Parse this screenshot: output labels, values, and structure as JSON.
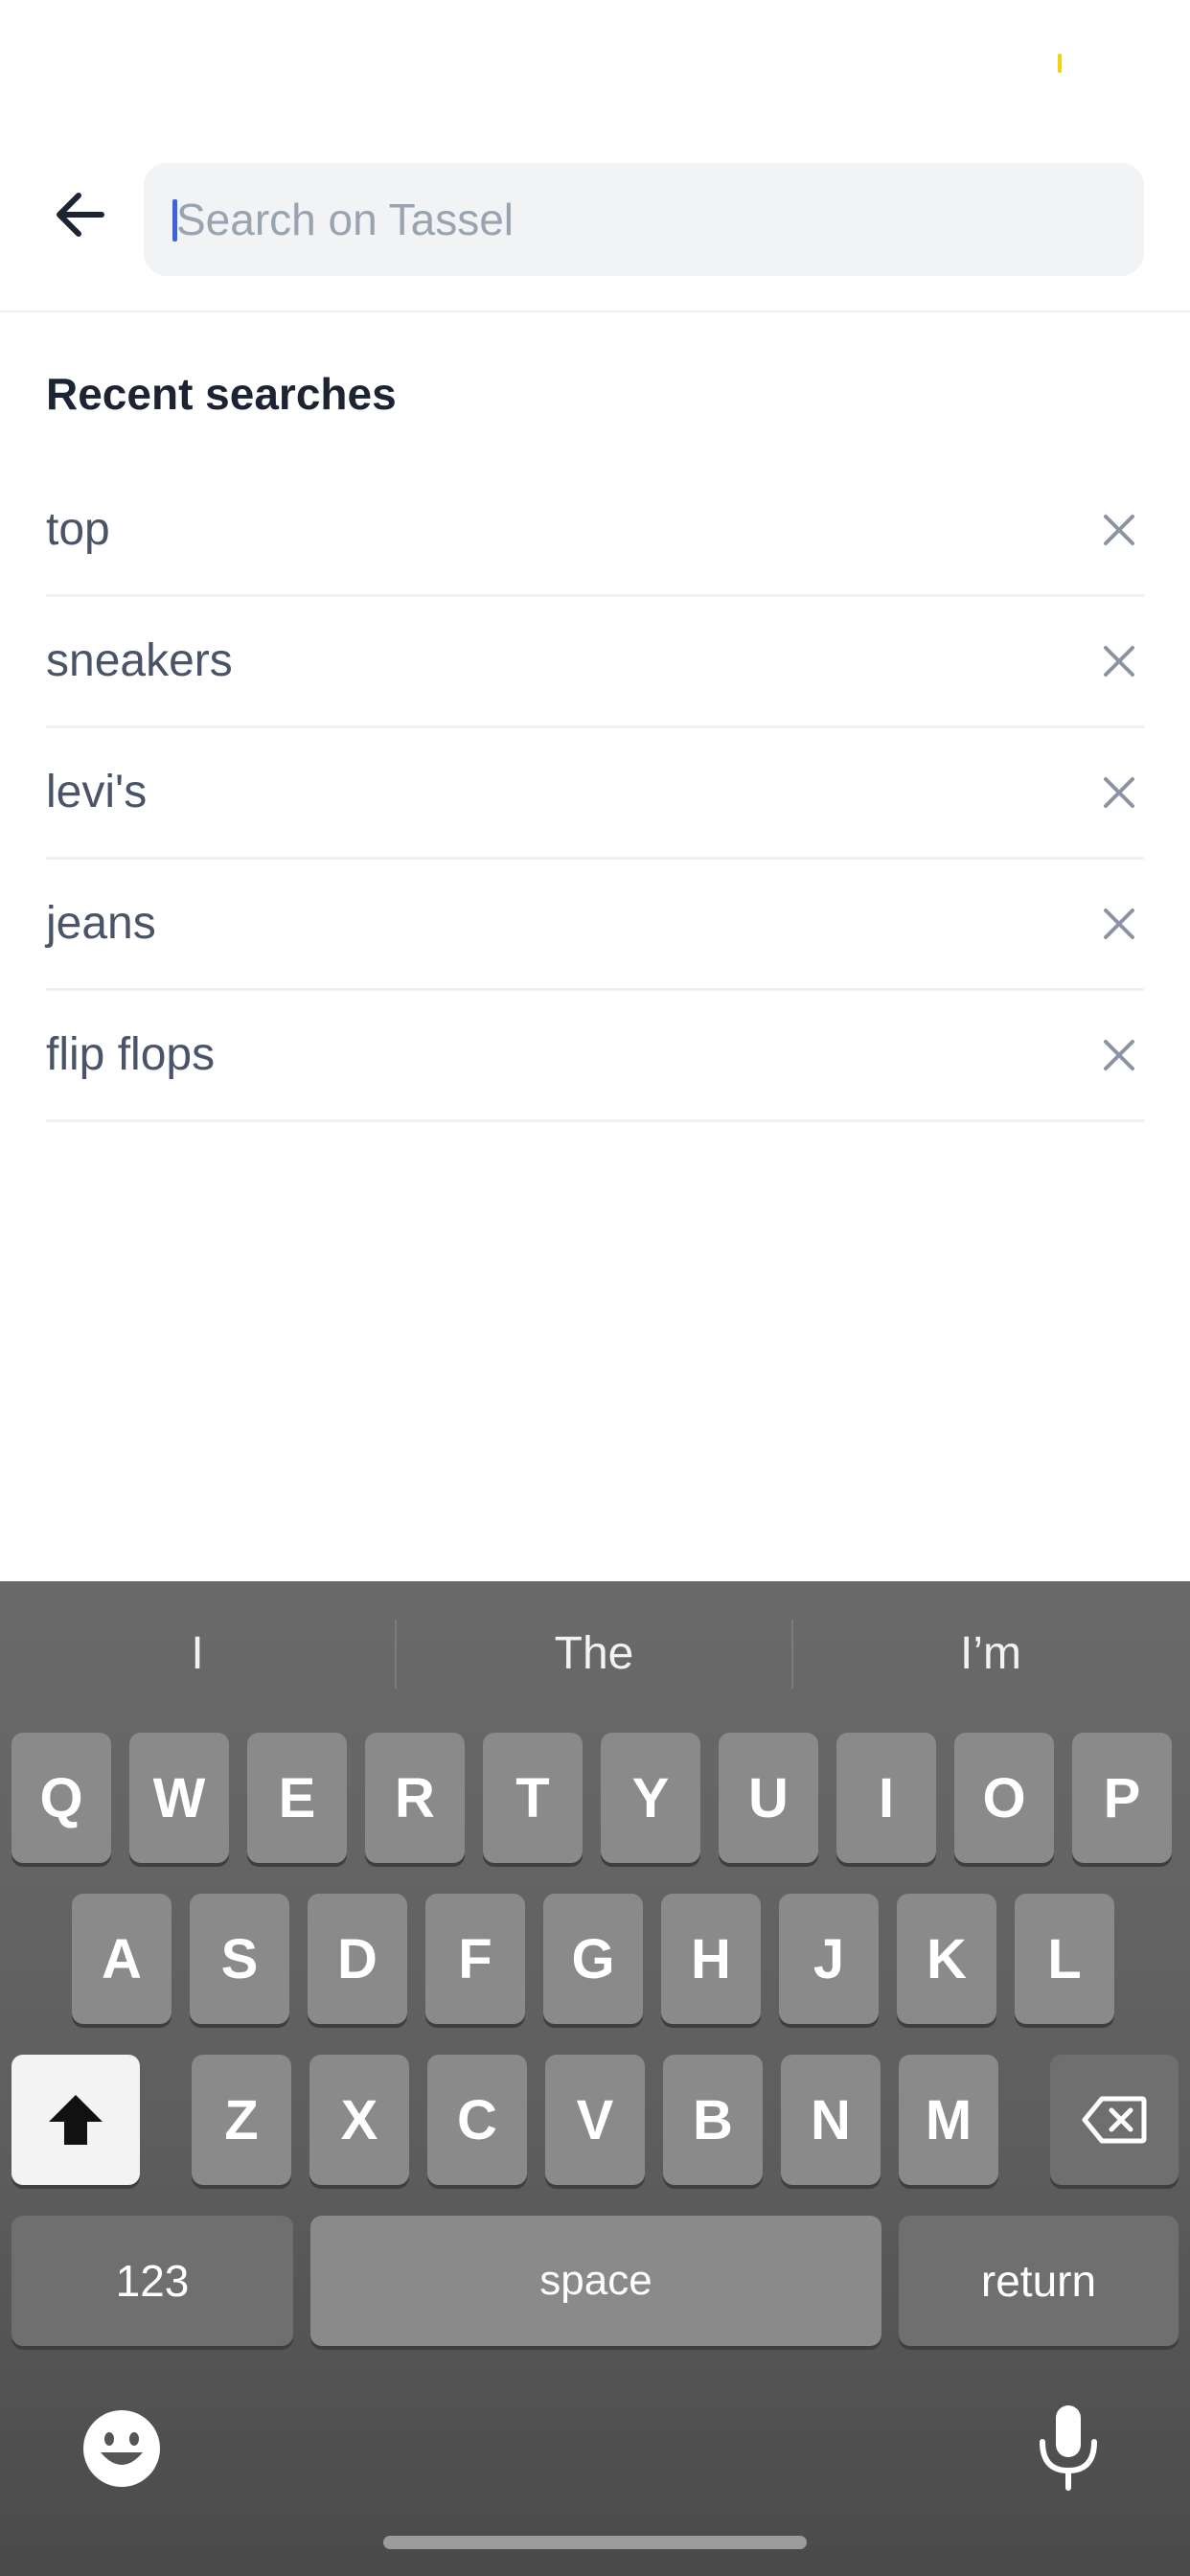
{
  "search": {
    "placeholder": "Search on Tassel"
  },
  "recent": {
    "title": "Recent searches",
    "items": [
      {
        "label": "top"
      },
      {
        "label": "sneakers"
      },
      {
        "label": "levi's"
      },
      {
        "label": "jeans"
      },
      {
        "label": "flip flops"
      }
    ]
  },
  "keyboard": {
    "suggestions": [
      "I",
      "The",
      "I’m"
    ],
    "row1": [
      "Q",
      "W",
      "E",
      "R",
      "T",
      "Y",
      "U",
      "I",
      "O",
      "P"
    ],
    "row2": [
      "A",
      "S",
      "D",
      "F",
      "G",
      "H",
      "J",
      "K",
      "L"
    ],
    "row3": [
      "Z",
      "X",
      "C",
      "V",
      "B",
      "N",
      "M"
    ],
    "numbers_label": "123",
    "space_label": "space",
    "return_label": "return"
  },
  "icons": {
    "back": "arrow-left-icon",
    "remove": "close-icon",
    "shift": "shift-icon",
    "delete": "backspace-icon",
    "emoji": "emoji-icon",
    "mic": "microphone-icon"
  },
  "colors": {
    "accent": "#3e63dd",
    "text_primary": "#1c2433",
    "text_secondary": "#4a5468",
    "placeholder": "#9aa3b0"
  }
}
